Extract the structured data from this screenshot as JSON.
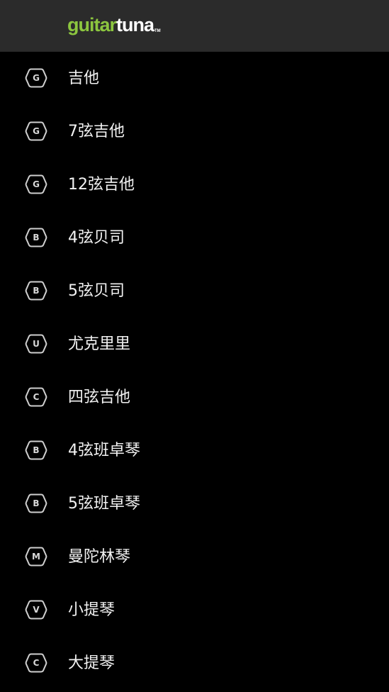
{
  "header": {
    "logo_part1": "guitar",
    "logo_part2": "tuna",
    "logo_tm": "TM",
    "brand_color": "#8cc63f",
    "background": "#2b2b2b"
  },
  "instruments": [
    {
      "badge": "G",
      "label": "吉他"
    },
    {
      "badge": "G",
      "label": "7弦吉他"
    },
    {
      "badge": "G",
      "label": "12弦吉他"
    },
    {
      "badge": "B",
      "label": "4弦贝司"
    },
    {
      "badge": "B",
      "label": "5弦贝司"
    },
    {
      "badge": "U",
      "label": "尤克里里"
    },
    {
      "badge": "C",
      "label": "四弦吉他"
    },
    {
      "badge": "B",
      "label": "4弦班卓琴"
    },
    {
      "badge": "B",
      "label": "5弦班卓琴"
    },
    {
      "badge": "M",
      "label": "曼陀林琴"
    },
    {
      "badge": "V",
      "label": "小提琴"
    },
    {
      "badge": "C",
      "label": "大提琴"
    }
  ]
}
